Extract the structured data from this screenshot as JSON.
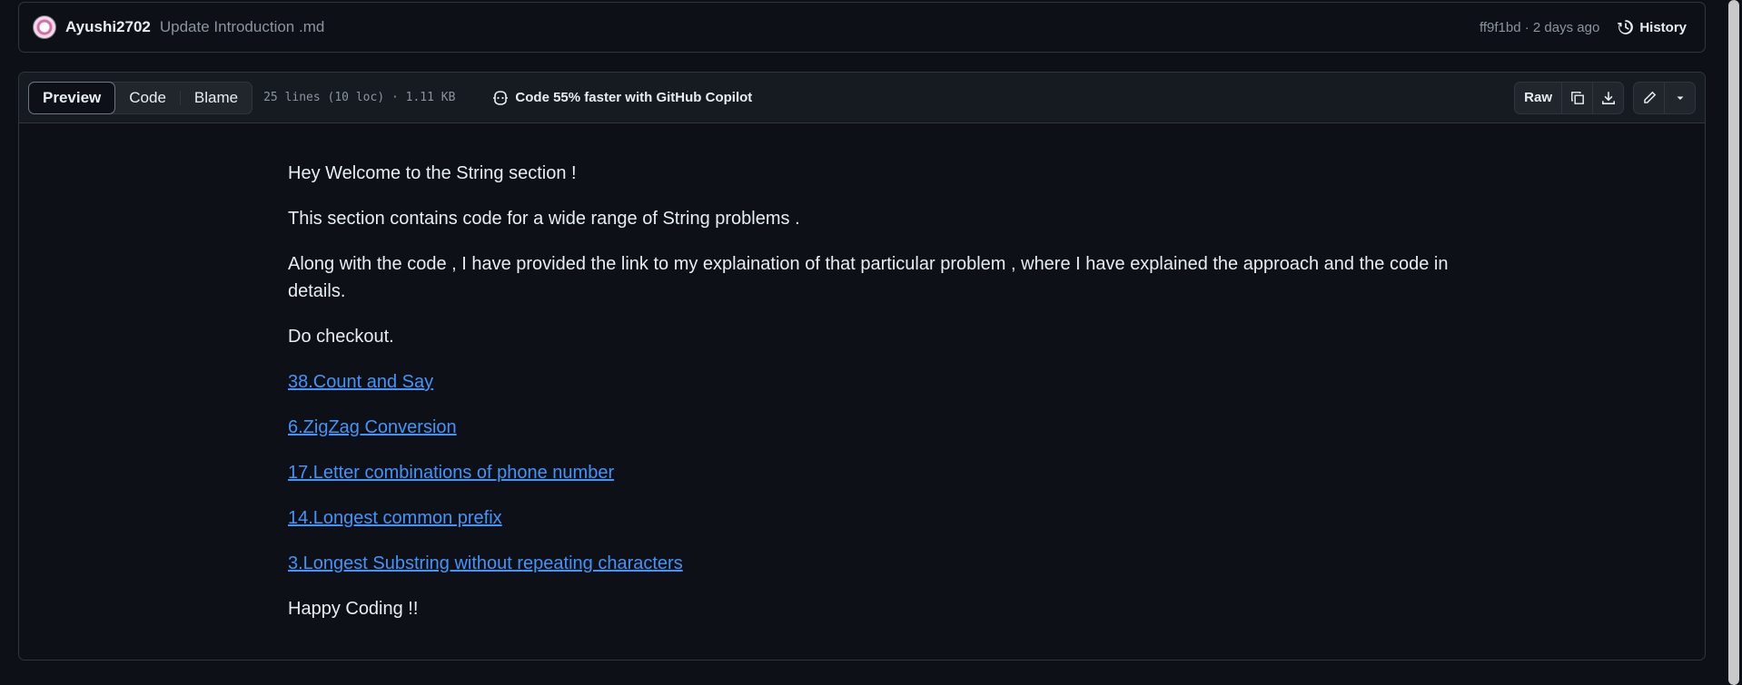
{
  "commit": {
    "author": "Ayushi2702",
    "message": "Update Introduction .md",
    "meta": "ff9f1bd · 2 days ago",
    "history_label": "History"
  },
  "file_header": {
    "tabs": [
      {
        "label": "Preview",
        "active": true
      },
      {
        "label": "Code",
        "active": false
      },
      {
        "label": "Blame",
        "active": false
      }
    ],
    "file_meta": "25 lines (10 loc) · 1.11 KB",
    "copilot_label": "Code 55% faster with GitHub Copilot",
    "raw_label": "Raw"
  },
  "content": {
    "paragraphs": [
      "Hey Welcome to the String section !",
      "This section contains code for a wide range of String problems .",
      "Along with the code , I have provided the link to my explaination of that particular problem , where I have explained the approach and the code in details.",
      "Do checkout."
    ],
    "links": [
      "38.Count and Say",
      "6.ZigZag Conversion",
      "17.Letter combinations of phone number",
      "14.Longest common prefix",
      "3.Longest Substring without repeating characters"
    ],
    "closing": "Happy Coding !!"
  },
  "icons": {
    "history": "history-icon",
    "copilot": "copilot-icon",
    "copy": "copy-icon",
    "download": "download-icon",
    "edit": "pencil-icon",
    "more": "triangle-down-icon"
  },
  "colors": {
    "background": "#0d1117",
    "link": "#4493f8",
    "border": "#30363d",
    "muted": "#8b949e"
  }
}
